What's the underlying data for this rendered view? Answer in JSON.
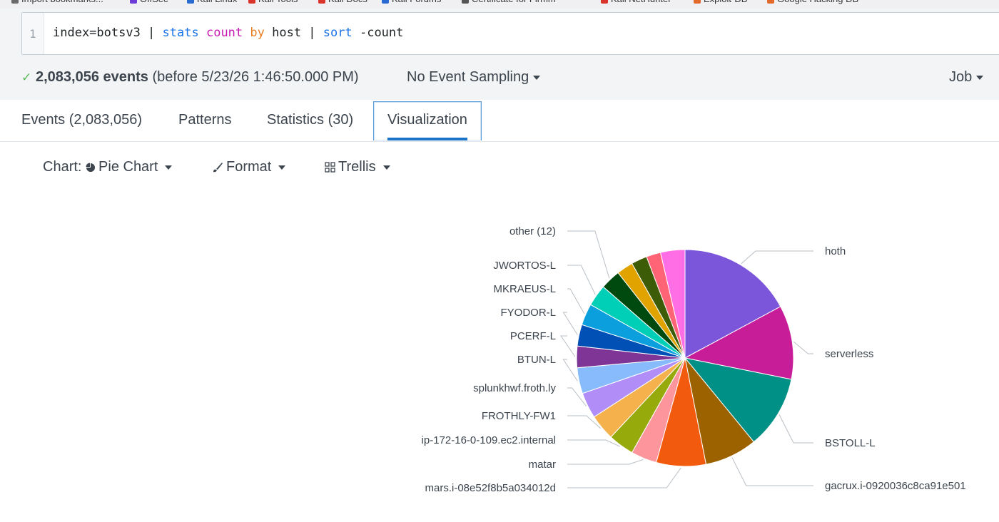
{
  "bookmarks": [
    {
      "label": "Import bookmarks...",
      "color": "#6a6a6a"
    },
    {
      "label": "OffSec",
      "color": "#6d3bd6"
    },
    {
      "label": "Kali Linux",
      "color": "#2a6bd1"
    },
    {
      "label": "Kali Tools",
      "color": "#d9342b"
    },
    {
      "label": "Kali Docs",
      "color": "#d9342b"
    },
    {
      "label": "Kali Forums",
      "color": "#2a6bd1"
    },
    {
      "label": "Certificate for Firmm",
      "color": "#555555"
    },
    {
      "label": "Kali NetHunter",
      "color": "#d9342b"
    },
    {
      "label": "Exploit-DB",
      "color": "#e0692b"
    },
    {
      "label": "Google Hacking DB",
      "color": "#e0692b"
    }
  ],
  "search": {
    "line_number": "1",
    "tokens": [
      {
        "text": "index=botsv3 | ",
        "cls": ""
      },
      {
        "text": "stats",
        "cls": "q-blue"
      },
      {
        "text": " ",
        "cls": ""
      },
      {
        "text": "count",
        "cls": "q-magenta"
      },
      {
        "text": " ",
        "cls": ""
      },
      {
        "text": "by",
        "cls": "q-orange"
      },
      {
        "text": " host | ",
        "cls": ""
      },
      {
        "text": "sort",
        "cls": "q-blue"
      },
      {
        "text": " -count",
        "cls": ""
      }
    ]
  },
  "status": {
    "check": "✓",
    "events_count": "2,083,056 events",
    "before_text": "(before 5/23/26 1:46:50.000 PM)",
    "sampling_label": "No Event Sampling",
    "job_label": "Job"
  },
  "tabs": [
    {
      "label": "Events (2,083,056)",
      "active": false
    },
    {
      "label": "Patterns",
      "active": false
    },
    {
      "label": "Statistics (30)",
      "active": false
    },
    {
      "label": "Visualization",
      "active": true
    }
  ],
  "controls": {
    "chart_prefix": "Chart:",
    "chart_type": "Pie Chart",
    "format_label": "Format",
    "trellis_label": "Trellis"
  },
  "chart_data": {
    "type": "pie",
    "title": "",
    "slices": [
      {
        "label": "hoth",
        "value": 16.0,
        "color": "#7b56db"
      },
      {
        "label": "serverless",
        "value": 10.3,
        "color": "#c71d99"
      },
      {
        "label": "BSTOLL-L",
        "value": 10.2,
        "color": "#009085"
      },
      {
        "label": "gacrux.i-0920036c8ca91e501",
        "value": 7.3,
        "color": "#9d6200"
      },
      {
        "label": "mars.i-08e52f8b5a034012d",
        "value": 6.9,
        "color": "#f25a0e"
      },
      {
        "label": "matar",
        "value": 3.6,
        "color": "#fd959d"
      },
      {
        "label": "ip-172-16-0-109.ec2.internal",
        "value": 3.6,
        "color": "#97aa0c"
      },
      {
        "label": "FROTHLY-FW1",
        "value": 3.6,
        "color": "#f5b14c"
      },
      {
        "label": "splunkhwf.froth.ly",
        "value": 3.6,
        "color": "#b08df7"
      },
      {
        "label": "BTUN-L",
        "value": 3.6,
        "color": "#88bbfc"
      },
      {
        "label": "PCERF-L",
        "value": 3.0,
        "color": "#7f3596"
      },
      {
        "label": "FYODOR-L",
        "value": 3.0,
        "color": "#0050b5"
      },
      {
        "label": "MKRAEUS-L",
        "value": 3.0,
        "color": "#0b9fdd"
      },
      {
        "label": "JWORTOS-L",
        "value": 3.0,
        "color": "#00cfb8"
      },
      {
        "label": "other (12)",
        "value": 2.8,
        "color": "#004a10"
      },
      {
        "label": "",
        "value": 2.3,
        "color": "#e0a300"
      },
      {
        "label": "",
        "value": 2.2,
        "color": "#3d5c07"
      },
      {
        "label": "",
        "value": 2.0,
        "color": "#ff6476"
      },
      {
        "label": "",
        "value": 3.4,
        "color": "#ff6ee4"
      }
    ]
  }
}
